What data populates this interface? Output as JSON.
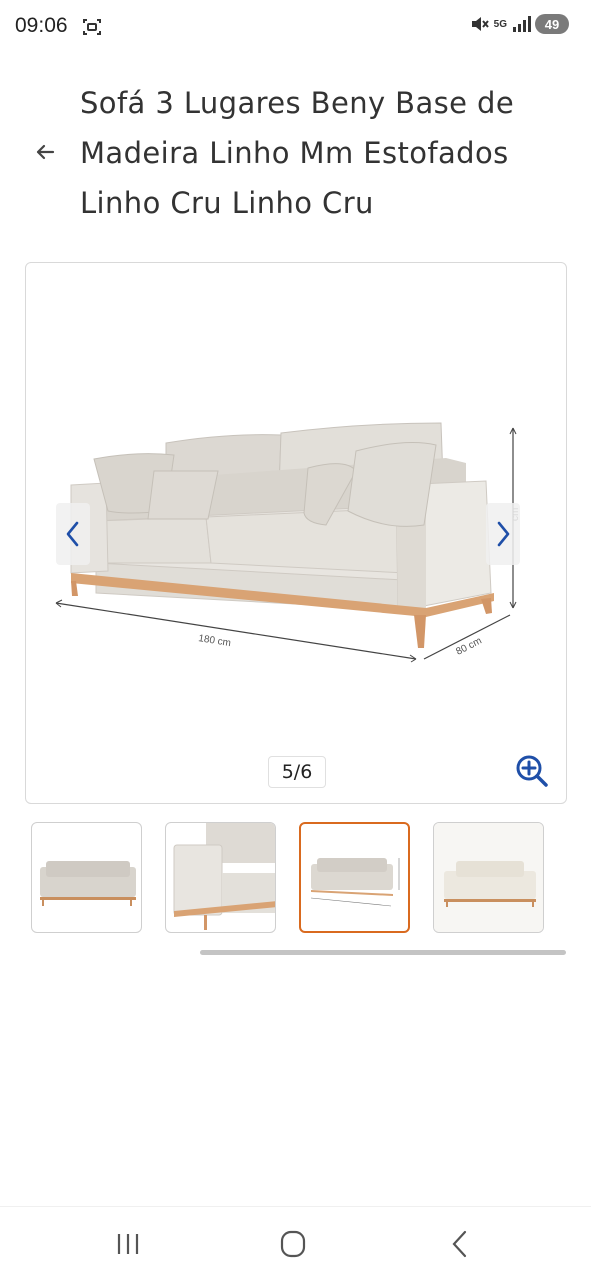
{
  "status_bar": {
    "time": "09:06",
    "network": "5G",
    "battery": "49",
    "icons": [
      "screenshot-icon",
      "mute-icon",
      "5g-icon",
      "signal-icon",
      "battery-icon"
    ]
  },
  "header": {
    "back_icon": "arrow-left-icon",
    "title": "Sofá 3 Lugares Beny Base de Madeira Linho Mm Estofados Linho Cru Linho Cru"
  },
  "gallery": {
    "counter": "5/6",
    "current_index": 5,
    "total": 6,
    "dimensions": {
      "width_label": "180 cm",
      "depth_label": "80 cm",
      "height_label": "cm"
    },
    "icons": [
      "chevron-left-icon",
      "chevron-right-icon",
      "zoom-in-icon"
    ]
  },
  "thumbnails": {
    "count_visible": 4,
    "active_index": 2
  },
  "colors": {
    "accent_orange": "#d96a1f",
    "arrow_blue": "#1f4fa8",
    "sofa_fabric": "#e7e4df",
    "wood": "#d9a374"
  },
  "nav_bar": {
    "icons": [
      "recent-apps-icon",
      "home-icon",
      "back-icon"
    ]
  }
}
